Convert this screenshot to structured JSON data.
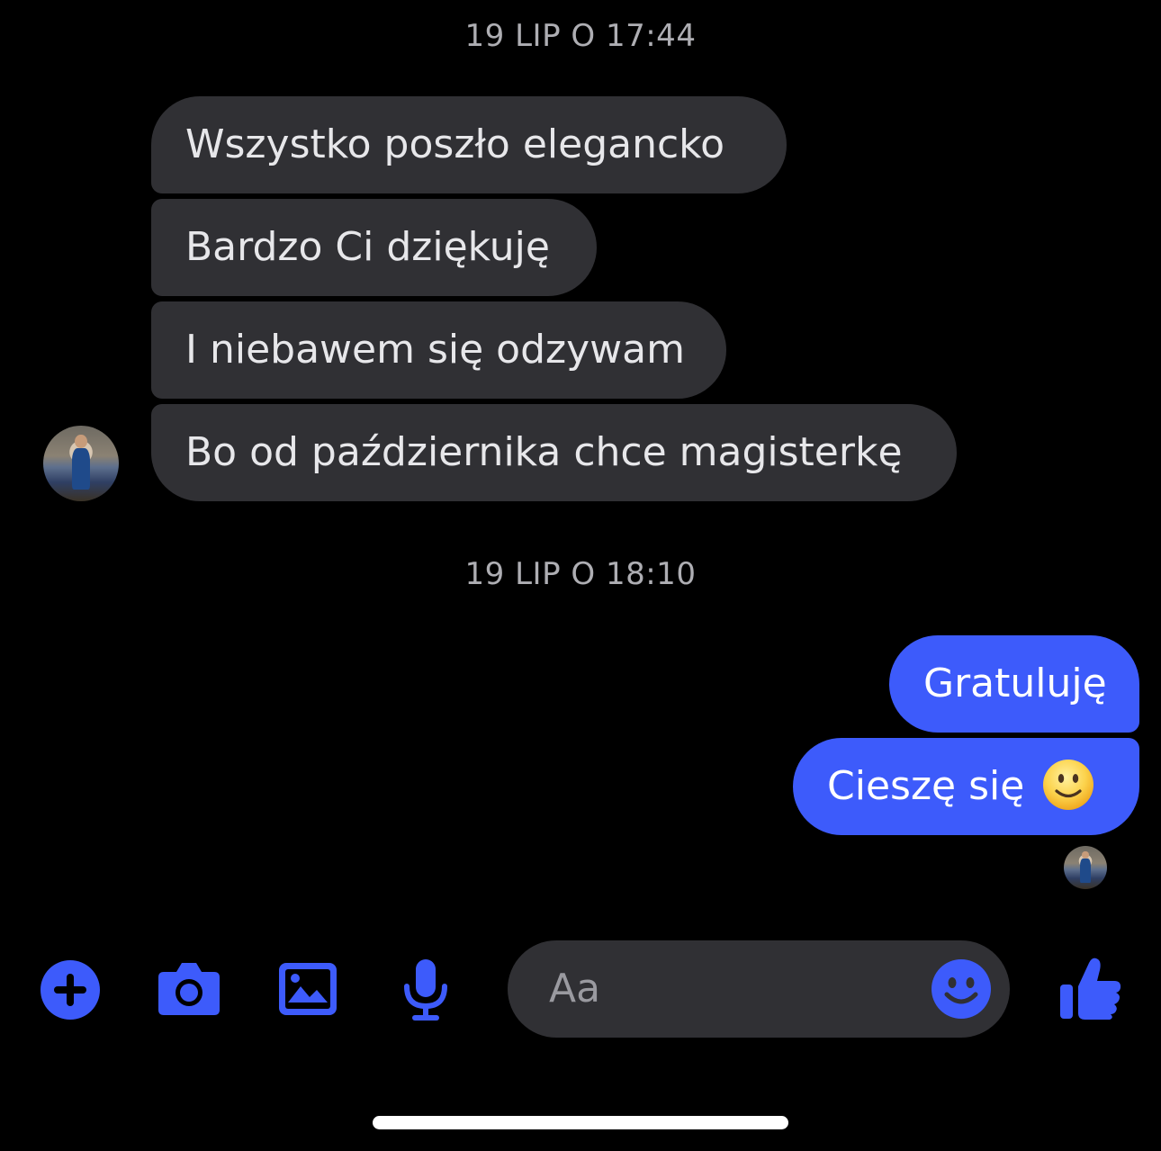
{
  "timestamps": {
    "first": "19 LIP O 17:44",
    "second": "19 LIP O 18:10"
  },
  "incoming_messages": [
    "Wszystko poszło elegancko",
    "Bardzo Ci dziękuję",
    "I niebawem się odzywam",
    "Bo od października chce magisterkę"
  ],
  "outgoing_messages": [
    "Gratuluję",
    "Cieszę się"
  ],
  "composer": {
    "placeholder": "Aa"
  },
  "colors": {
    "accent": "#3d5bfb",
    "incoming_bubble": "#303034",
    "background": "#000000",
    "timestamp": "#aeaeb3"
  },
  "icons": {
    "add": "plus-circle-icon",
    "camera": "camera-icon",
    "gallery": "photo-icon",
    "voice": "microphone-icon",
    "emoji": "smiley-icon",
    "like": "thumbs-up-icon",
    "outgoing_emoji": "slightly-smiling-face-emoji"
  }
}
